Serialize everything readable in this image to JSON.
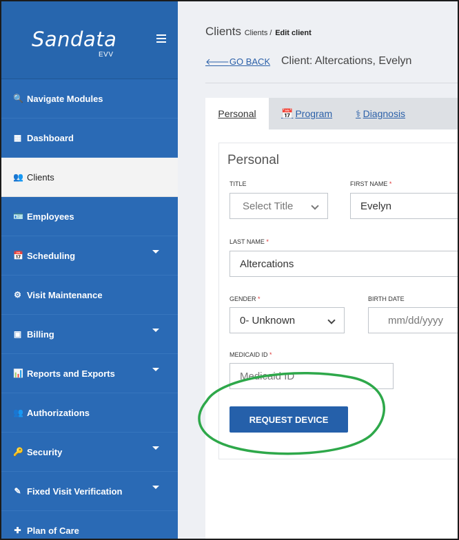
{
  "brand": {
    "logo": "Sandata",
    "sub": "EVV"
  },
  "sidebar": {
    "items": [
      {
        "label": "Navigate Modules",
        "icon": "search-icon",
        "active": false,
        "caret": false
      },
      {
        "label": "Dashboard",
        "icon": "grid-icon",
        "active": false,
        "caret": false
      },
      {
        "label": "Clients",
        "icon": "users-icon",
        "active": true,
        "caret": false
      },
      {
        "label": "Employees",
        "icon": "id-card-icon",
        "active": false,
        "caret": false
      },
      {
        "label": "Scheduling",
        "icon": "calendar-icon",
        "active": false,
        "caret": true
      },
      {
        "label": "Visit Maintenance",
        "icon": "cogs-icon",
        "active": false,
        "caret": false
      },
      {
        "label": "Billing",
        "icon": "money-icon",
        "active": false,
        "caret": true
      },
      {
        "label": "Reports and Exports",
        "icon": "bar-chart-icon",
        "active": false,
        "caret": true
      },
      {
        "label": "Authorizations",
        "icon": "users-icon",
        "active": false,
        "caret": false
      },
      {
        "label": "Security",
        "icon": "key-icon",
        "active": false,
        "caret": true
      },
      {
        "label": "Fixed Visit Verification",
        "icon": "edit-icon",
        "active": false,
        "caret": true
      },
      {
        "label": "Plan of Care",
        "icon": "medkit-icon",
        "active": false,
        "caret": false
      }
    ]
  },
  "header": {
    "title": "Clients",
    "crumb_parent": "Clients /",
    "crumb_current": "Edit client",
    "back_label": "GO BACK",
    "client_title": "Client: Altercations, Evelyn"
  },
  "tabs": [
    {
      "label": "Personal",
      "active": true
    },
    {
      "label": "Program",
      "icon": "calendar-icon",
      "active": false
    },
    {
      "label": "Diagnosis",
      "icon": "stethoscope-icon",
      "active": false
    }
  ],
  "form": {
    "section_title": "Personal",
    "title": {
      "label": "TITLE",
      "value": "Select Title"
    },
    "first_name": {
      "label": "FIRST NAME",
      "value": "Evelyn",
      "required": "*"
    },
    "last_name": {
      "label": "LAST NAME",
      "value": "Altercations",
      "required": "*"
    },
    "gender": {
      "label": "GENDER",
      "value": "0- Unknown",
      "required": "*"
    },
    "birth_date": {
      "label": "BIRTH DATE",
      "placeholder": "mm/dd/yyyy"
    },
    "medicaid_id": {
      "label": "MEDICAID ID",
      "placeholder": "Medicaid ID",
      "required": "*"
    },
    "request_button": "REQUEST DEVICE"
  },
  "colors": {
    "sidebar": "#2a6ab5",
    "active_item": "#f3f3f3",
    "accent": "#2560aa",
    "annotation": "#2ea84a"
  }
}
